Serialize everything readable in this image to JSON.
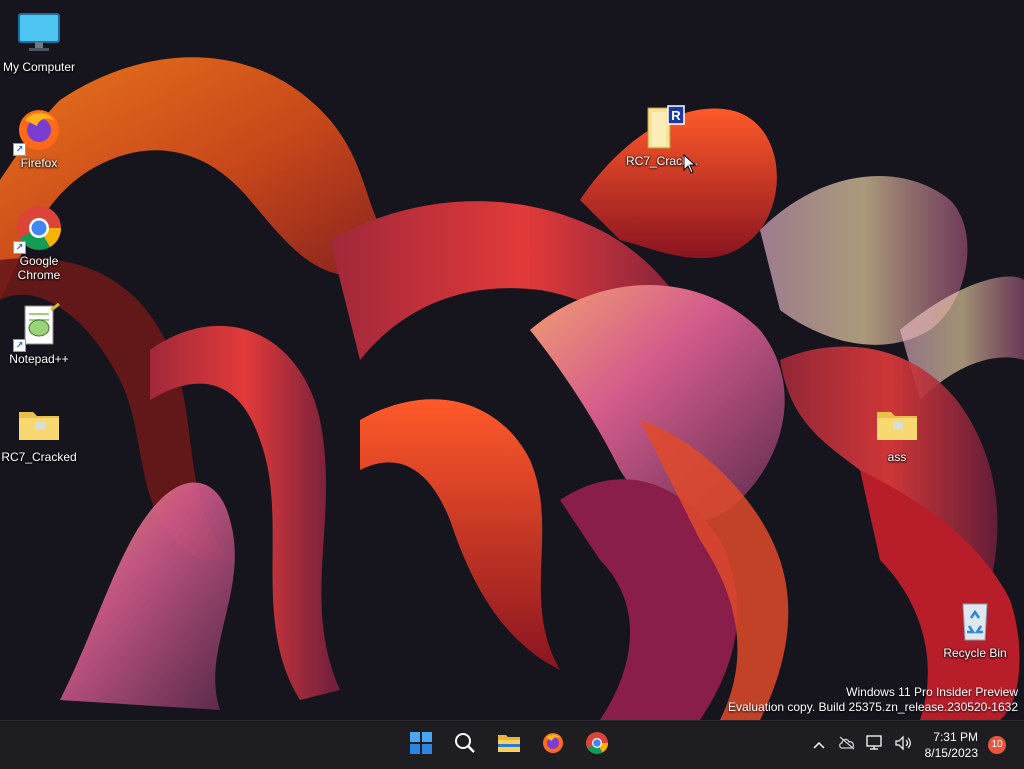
{
  "desktop": {
    "icons": [
      {
        "label": "My Computer",
        "icon": "monitor-icon"
      },
      {
        "label": "Firefox",
        "icon": "firefox-icon"
      },
      {
        "label": "Google Chrome",
        "icon": "chrome-icon"
      },
      {
        "label": "Notepad++",
        "icon": "notepadpp-icon"
      },
      {
        "label": "RC7_Cracked",
        "icon": "folder-icon"
      },
      {
        "label": "RC7_Crack...",
        "icon": "rar-archive-icon",
        "badge": "R"
      },
      {
        "label": "ass",
        "icon": "folder-icon"
      },
      {
        "label": "Recycle Bin",
        "icon": "recycle-bin-icon"
      }
    ],
    "watermark": {
      "line1": "Windows 11 Pro Insider Preview",
      "line2": "Evaluation copy. Build 25375.zn_release.230520-1632"
    }
  },
  "taskbar": {
    "pinned": [
      "start-icon",
      "search-icon",
      "file-explorer-icon",
      "firefox-icon",
      "chrome-icon"
    ],
    "tray": {
      "time": "7:31 PM",
      "date": "8/15/2023",
      "notification_count": "10"
    }
  },
  "colors": {
    "taskbar_bg": "#1d1d22",
    "accent_blue": "#0a74da",
    "notification_badge": "#e8563d",
    "wallpaper_base": "#16151d"
  }
}
